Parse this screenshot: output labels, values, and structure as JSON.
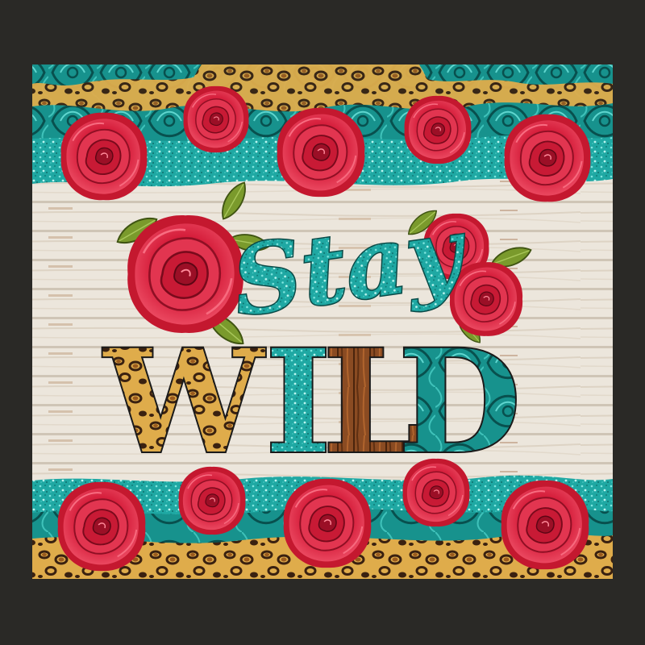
{
  "design": {
    "script_word": "Stay",
    "block_letters": [
      {
        "char": "W",
        "texture": "leopard"
      },
      {
        "char": "I",
        "texture": "turquoise"
      },
      {
        "char": "L",
        "texture": "wood"
      },
      {
        "char": "D",
        "texture": "tooled-turquoise"
      }
    ]
  },
  "colors": {
    "background": "#2a2926",
    "turquoise": "#1fa8a3",
    "turquoise_dark": "#0d6f6c",
    "rose_red": "#d61f3c",
    "rose_dark": "#8f0f24",
    "leaf_green": "#7a9a2c",
    "leopard_gold": "#d9a441",
    "wood_brown": "#8a4b22",
    "plank_white": "#ece6dc"
  },
  "motifs": {
    "top_border": [
      "tooled-leather",
      "leopard-print",
      "turquoise-glitter",
      "red-roses"
    ],
    "bottom_border": [
      "turquoise-glitter",
      "tooled-leather",
      "leopard-print",
      "red-roses"
    ],
    "center_background": "whitewashed-wood-planks"
  }
}
